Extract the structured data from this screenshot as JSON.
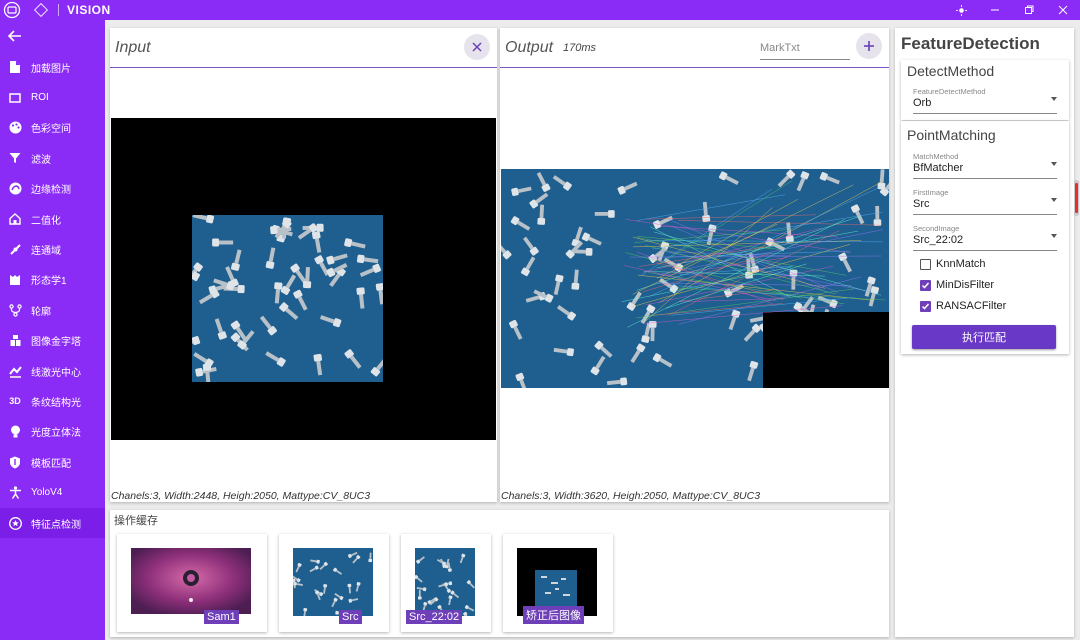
{
  "app": {
    "title": "VISION"
  },
  "nav": [
    {
      "label": "加载图片",
      "icon": "file-icon"
    },
    {
      "label": "ROI",
      "icon": "rectangle-icon"
    },
    {
      "label": "色彩空间",
      "icon": "palette-icon"
    },
    {
      "label": "滤波",
      "icon": "filter-icon"
    },
    {
      "label": "边缘检测",
      "icon": "edge-icon"
    },
    {
      "label": "二值化",
      "icon": "home-icon"
    },
    {
      "label": "连通域",
      "icon": "connect-icon"
    },
    {
      "label": "形态学1",
      "icon": "morph-icon"
    },
    {
      "label": "轮廓",
      "icon": "contour-icon"
    },
    {
      "label": "图像金字塔",
      "icon": "pyramid-icon"
    },
    {
      "label": "线激光中心",
      "icon": "laser-icon"
    },
    {
      "label": "条纹结构光",
      "icon": "3d-icon",
      "glyph": "3D"
    },
    {
      "label": "光度立体法",
      "icon": "bulb-icon"
    },
    {
      "label": "模板匹配",
      "icon": "shield-icon"
    },
    {
      "label": "YoloV4",
      "icon": "person-icon"
    },
    {
      "label": "特征点检测",
      "icon": "star-icon"
    }
  ],
  "input": {
    "title": "Input",
    "info": "Chanels:3, Width:2448, Heigh:2050, Mattype:CV_8UC3"
  },
  "output": {
    "title": "Output",
    "time": "170ms",
    "mark_placeholder": "MarkTxt",
    "info": "Chanels:3, Width:3620, Heigh:2050, Mattype:CV_8UC3"
  },
  "cache": {
    "title": "操作缓存",
    "items": [
      {
        "label": "Sam1"
      },
      {
        "label": "Src"
      },
      {
        "label": "Src_22:02"
      },
      {
        "label": "矫正后图像"
      }
    ]
  },
  "feature": {
    "title": "FeatureDetection",
    "detect": {
      "title": "DetectMethod",
      "method_label": "FeatureDetectMethod",
      "method_value": "Orb"
    },
    "matching": {
      "title": "PointMatching",
      "match_label": "MatchMethod",
      "match_value": "BfMatcher",
      "first_label": "FirstImage",
      "first_value": "Src",
      "second_label": "SecondImage",
      "second_value": "Src_22:02",
      "checks": [
        {
          "label": "KnnMatch",
          "checked": false
        },
        {
          "label": "MinDisFilter",
          "checked": true
        },
        {
          "label": "RANSACFilter",
          "checked": true
        }
      ],
      "run_label": "执行匹配"
    }
  },
  "colors": {
    "accent": "#8b2cf6",
    "button": "#6a38c6",
    "image_bg": "#1f5f8f"
  }
}
